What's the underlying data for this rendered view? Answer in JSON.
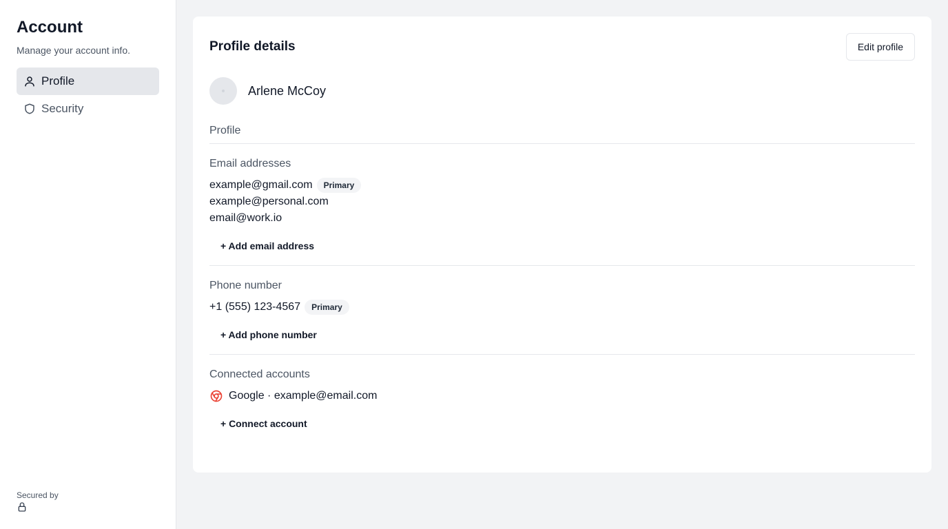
{
  "sidebar": {
    "title": "Account",
    "subtitle": "Manage your account info.",
    "items": [
      {
        "label": "Profile",
        "icon": "user-icon",
        "active": true
      },
      {
        "label": "Security",
        "icon": "shield-icon",
        "active": false
      }
    ],
    "secured_by": "Secured by"
  },
  "card": {
    "title": "Profile details",
    "edit_label": "Edit profile",
    "user_name": "Arlene McCoy",
    "profile_label": "Profile",
    "emails": {
      "label": "Email addresses",
      "items": [
        {
          "address": "example@gmail.com",
          "badge": "Primary"
        },
        {
          "address": "example@personal.com"
        },
        {
          "address": "email@work.io"
        }
      ],
      "add_label": "+ Add email address"
    },
    "phone": {
      "label": "Phone number",
      "number": "+1 (555) 123-4567",
      "badge": "Primary",
      "add_label": "+ Add phone number"
    },
    "connected": {
      "label": "Connected accounts",
      "account": "Google · example@email.com",
      "icon": "google-icon",
      "add_label": "+ Connect account"
    }
  },
  "colors": {
    "sidebar_bg": "#ffffff",
    "page_bg": "#f2f3f5",
    "active_nav_bg": "#e5e7eb",
    "google_red": "#ea4335"
  }
}
